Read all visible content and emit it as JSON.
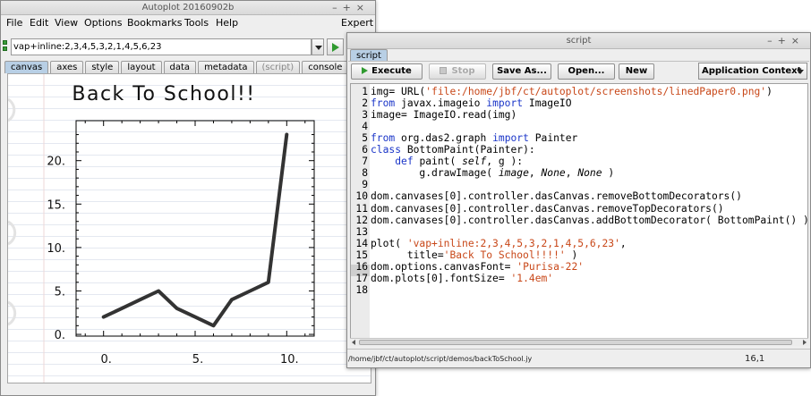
{
  "main_window": {
    "title": "Autoplot 20160902b",
    "menus": [
      "File",
      "Edit",
      "View",
      "Options",
      "Bookmarks",
      "Tools",
      "Help"
    ],
    "expert_label": "Expert",
    "uri_value": "vap+inline:2,3,4,5,3,2,1,4,5,6,23",
    "tabs": [
      "canvas",
      "axes",
      "style",
      "layout",
      "data",
      "metadata",
      "(script)",
      "console"
    ],
    "active_tab": "canvas"
  },
  "chart_data": {
    "type": "line",
    "title": "Back To School!!",
    "x": [
      0,
      1,
      2,
      3,
      4,
      5,
      6,
      7,
      8,
      9,
      10
    ],
    "values": [
      2,
      3,
      4,
      5,
      3,
      2,
      1,
      4,
      5,
      6,
      23
    ],
    "xticks": [
      "0.",
      "5.",
      "10."
    ],
    "yticks": [
      "0.",
      "5.",
      "10.",
      "15.",
      "20."
    ],
    "xlim": [
      -1.5,
      11.5
    ],
    "ylim": [
      -0.2,
      24.6
    ],
    "line_color": "#333333",
    "grid": false
  },
  "script_window": {
    "title": "script",
    "tab": "script",
    "buttons": {
      "execute": "Execute",
      "stop": "Stop",
      "save_as": "Save As...",
      "open": "Open...",
      "new": "New"
    },
    "context_select": "Application Context",
    "status_path": "/home/jbf/ct/autoplot/script/demos/backToSchool.jy",
    "cursor_position": "16,1",
    "lines": [
      "img= URL('file:/home/jbf/ct/autoplot/screenshots/linedPaper0.png')",
      "from javax.imageio import ImageIO",
      "image= ImageIO.read(img)",
      "",
      "from org.das2.graph import Painter",
      "class BottomPaint(Painter):",
      "    def paint( self, g ):",
      "        g.drawImage( image, None, None )",
      "",
      "dom.canvases[0].controller.dasCanvas.removeBottomDecorators()",
      "dom.canvases[0].controller.dasCanvas.removeTopDecorators()",
      "dom.canvases[0].controller.dasCanvas.addBottomDecorator( BottomPaint() )",
      "",
      "plot( 'vap+inline:2,3,4,5,3,2,1,4,5,6,23',",
      "      title='Back To School!!!!' )",
      "dom.options.canvasFont= 'Purisa-22'",
      "dom.plots[0].fontSize= '1.4em'",
      ""
    ],
    "line_numbers": [
      "1",
      "2",
      "3",
      "4",
      "5",
      "6",
      "7",
      "8",
      "9",
      "10",
      "11",
      "12",
      "13",
      "14",
      "15",
      "16",
      "17",
      "18"
    ],
    "highlighted_line": "16"
  }
}
